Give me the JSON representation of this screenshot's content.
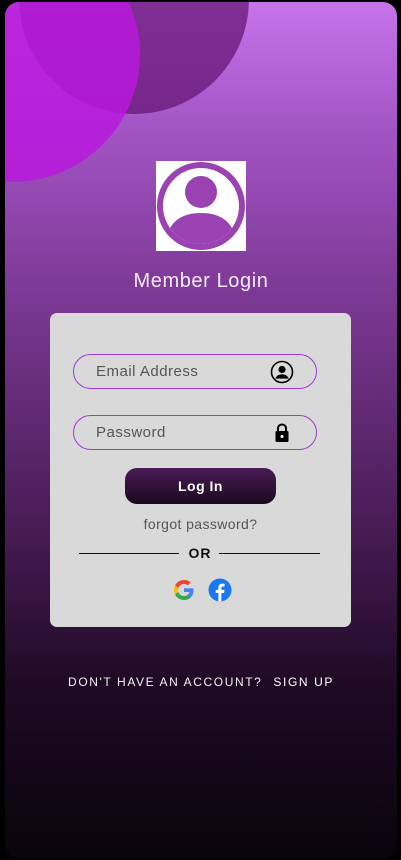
{
  "login": {
    "title": "Member Login",
    "email": {
      "placeholder": "Email Address",
      "value": "",
      "icon": "user-circle-icon"
    },
    "password": {
      "placeholder": "Password",
      "value": "",
      "icon": "lock-icon"
    },
    "login_button": "Log In",
    "forgot_password": "forgot password?",
    "or_label": "OR",
    "social": [
      {
        "name": "google",
        "icon": "google-icon"
      },
      {
        "name": "facebook",
        "icon": "facebook-icon"
      }
    ]
  },
  "footer": {
    "prompt": "DON'T HAVE AN ACCOUNT?",
    "signup": "SIGN UP"
  },
  "colors": {
    "accent_border": "#9b3bd6",
    "card_bg": "#d9d9d9",
    "button_dark": "#1a0a1e",
    "circle_magenta": "#b919dc",
    "circle_plum": "#641473",
    "facebook_blue": "#1877f2"
  }
}
